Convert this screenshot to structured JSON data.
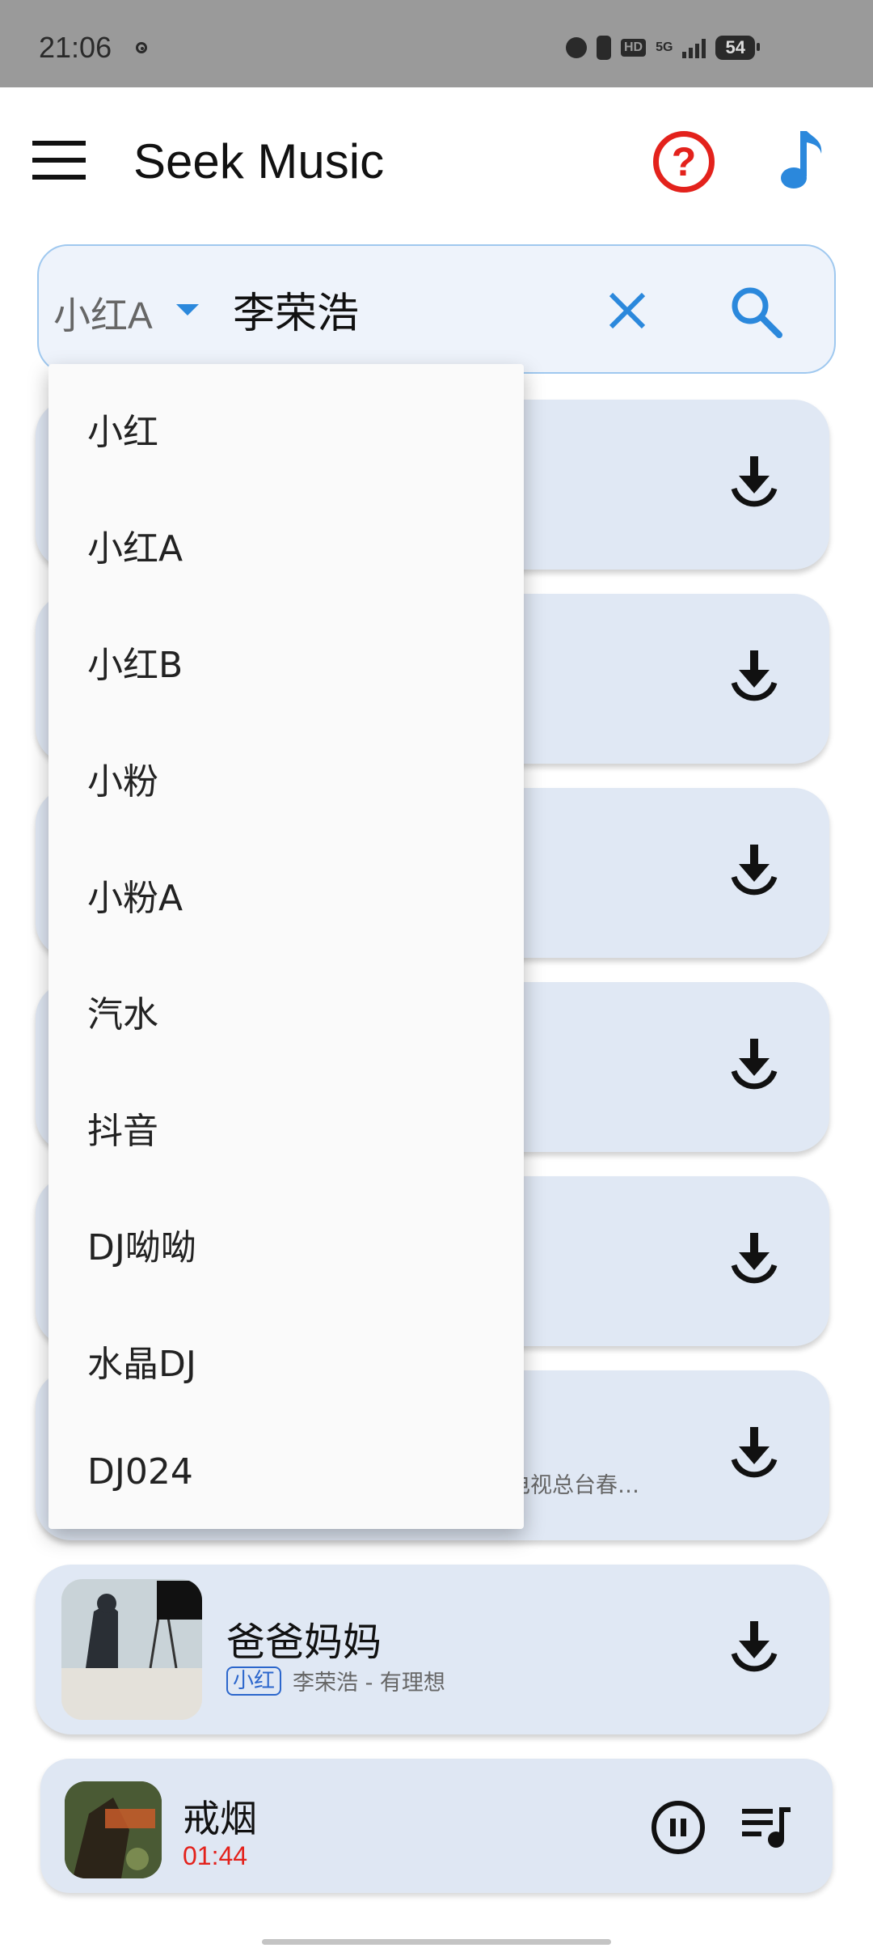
{
  "status_bar": {
    "time": "21:06",
    "hd": "HD",
    "network": "5G",
    "battery": "54"
  },
  "app_bar": {
    "title": "Seek Music"
  },
  "search": {
    "source_selected": "小红A",
    "query": "李荣浩"
  },
  "source_dropdown": {
    "options": [
      "小红",
      "小红A",
      "小红B",
      "小粉",
      "小粉A",
      "汽水",
      "抖音",
      "DJ呦呦",
      "水晶DJ",
      "DJ024"
    ]
  },
  "results": {
    "partial_subtitle": "播电视总台春…",
    "visible_song": {
      "title": "爸爸妈妈",
      "source_badge": "小红",
      "meta": "李荣浩 - 有理想"
    }
  },
  "player": {
    "title": "戒烟",
    "elapsed": "01:44"
  },
  "colors": {
    "accent_blue": "#2b88dc",
    "alert_red": "#e3221c",
    "card_bg": "#e0e8f4"
  }
}
